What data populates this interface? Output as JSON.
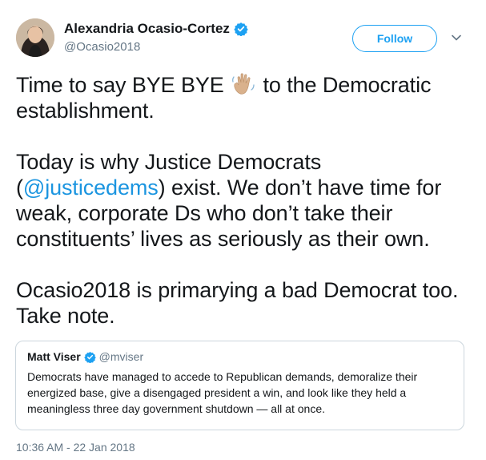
{
  "author": {
    "name": "Alexandria Ocasio-Cortez",
    "handle": "@Ocasio2018"
  },
  "follow_label": "Follow",
  "tweet": {
    "line1_a": "Time to say BYE BYE ",
    "line1_b": " to the Democratic establishment.",
    "p2_a": "Today is why Justice Democrats (",
    "p2_mention": "@justicedems",
    "p2_b": ") exist. We don’t have time for weak, corporate Ds who don’t take their constituents’ lives as seriously as their own.",
    "p3": "Ocasio2018 is primarying a bad Democrat too. Take note."
  },
  "quoted": {
    "name": "Matt Viser",
    "handle": "@mviser",
    "text": "Democrats have managed to accede to Republican demands, demoralize their energized base, give a disengaged president a win, and look like they held a meaningless three day government shutdown — all at once."
  },
  "timestamp": "10:36 AM - 22 Jan 2018",
  "colors": {
    "accent": "#1da1f2",
    "mention": "#1b95e0",
    "muted": "#657786",
    "border": "#ccd6dd"
  },
  "icons": [
    "verified-badge-icon",
    "waving-hand-icon",
    "chevron-down-icon"
  ]
}
